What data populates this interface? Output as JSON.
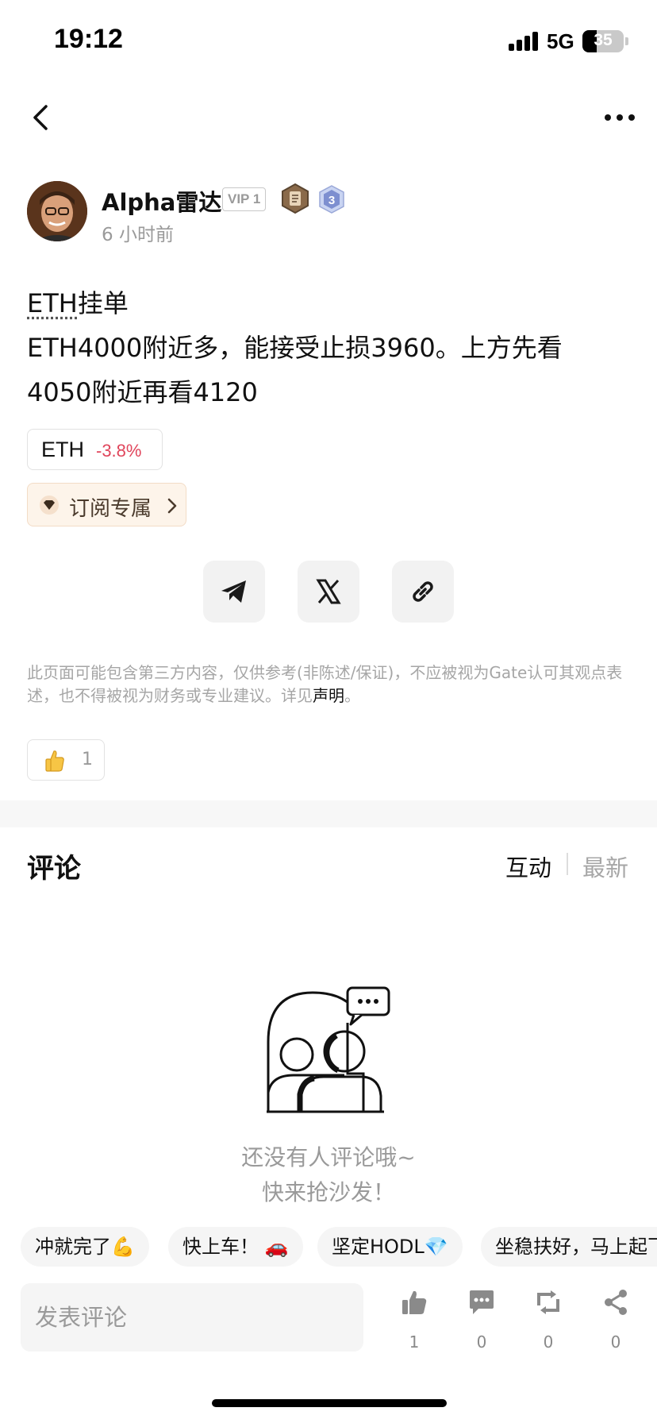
{
  "status_bar": {
    "time": "19:12",
    "network": "5G",
    "battery": "35",
    "battery_level": 0.35
  },
  "author": {
    "name": "Alpha雷达",
    "vip": "VIP 1",
    "level": "3",
    "time": "6 小时前"
  },
  "post": {
    "title_ticker": "ETH",
    "title_rest": "挂单",
    "line2": "ETH4000附近多，能接受止损3960。上方先看",
    "line3": "4050附近再看4120"
  },
  "coin_tag": {
    "symbol": "ETH",
    "change": "-3.8%"
  },
  "subscribe": {
    "label": "订阅专属"
  },
  "share_icons": [
    "telegram-icon",
    "x-icon",
    "link-icon"
  ],
  "disclaimer": {
    "text": "此页面可能包含第三方内容，仅供参考(非陈述/保证)，不应被视为Gate认可其观点表述，也不得被视为财务或专业建议。详见",
    "link": "声明",
    "end": "。"
  },
  "reactions": {
    "like_count": "1"
  },
  "comments": {
    "title": "评论",
    "sort_hot": "互动",
    "sort_new": "最新",
    "empty_line1": "还没有人评论哦~",
    "empty_line2": "快来抢沙发！"
  },
  "quick_replies": [
    "冲就完了💪",
    "快上车！ 🚗",
    "坚定HODL💎",
    "坐稳扶好，马上起飞"
  ],
  "bottom_bar": {
    "input_placeholder": "发表评论",
    "like_count": "1",
    "comment_count": "0",
    "repost_count": "0",
    "share_count": "0"
  },
  "colors": {
    "negative": "#e0455b",
    "subscribe_bg": "#fdf4ea",
    "muted": "#9a9a9a"
  }
}
